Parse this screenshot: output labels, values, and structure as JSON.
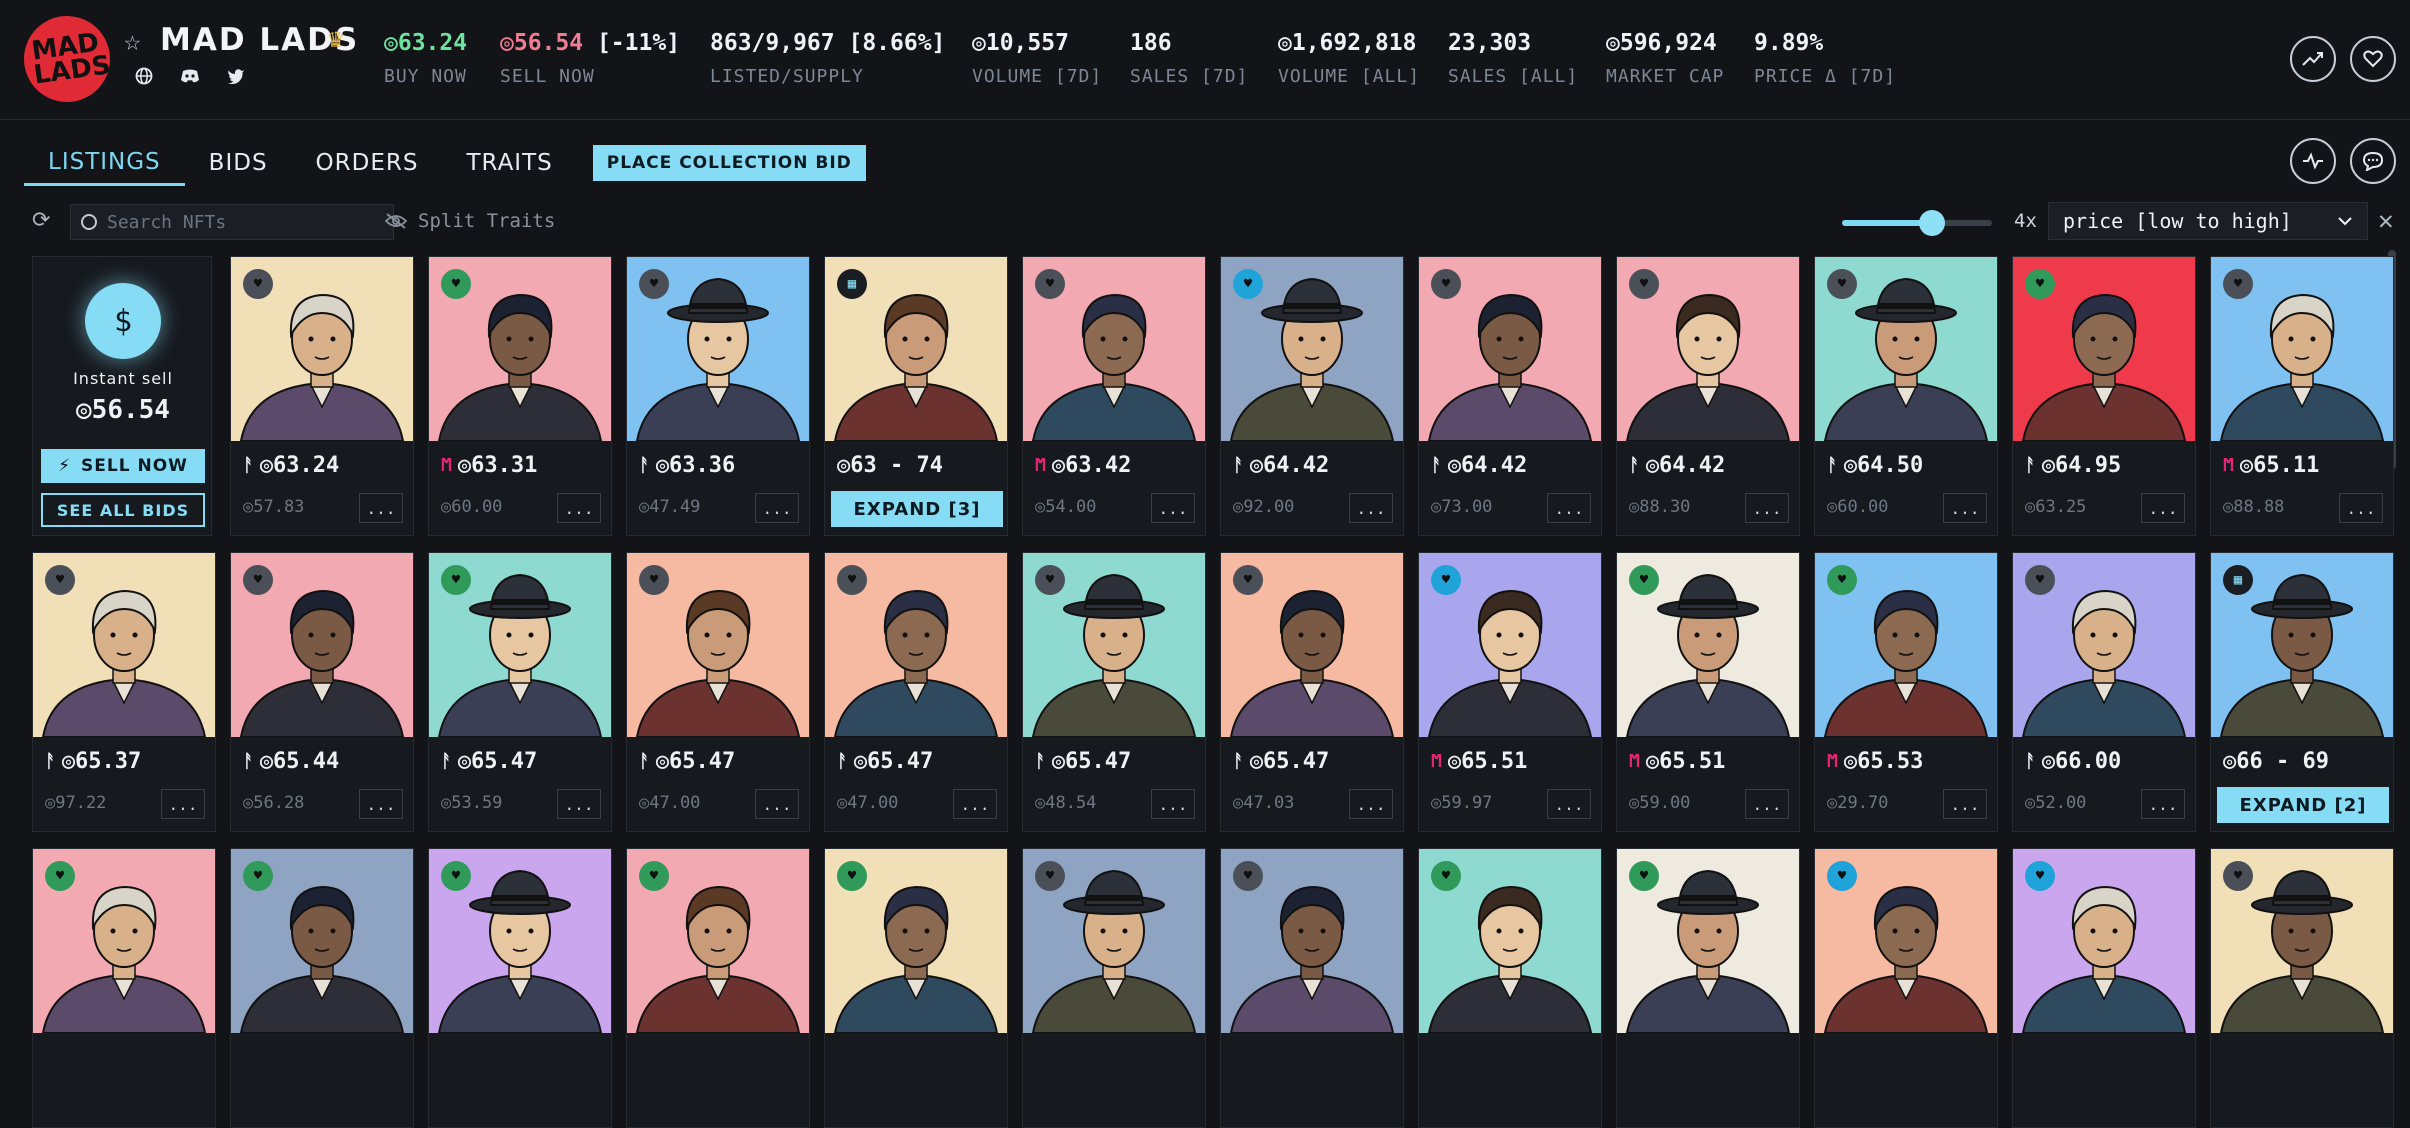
{
  "collection": {
    "logo_text": "MAD LADS",
    "title": "MAD LADS"
  },
  "stats": [
    {
      "value": "◎63.24",
      "label": "BUY NOW",
      "tone": "green"
    },
    {
      "value": "◎56.54",
      "extra": "[-11%]",
      "label": "SELL NOW",
      "tone": "red"
    },
    {
      "value": "863/9,967 [8.66%]",
      "label": "LISTED/SUPPLY"
    },
    {
      "value": "◎10,557",
      "label": "VOLUME [7D]"
    },
    {
      "value": "186",
      "label": "SALES [7D]"
    },
    {
      "value": "◎1,692,818",
      "label": "VOLUME [ALL]"
    },
    {
      "value": "23,303",
      "label": "SALES [ALL]"
    },
    {
      "value": "◎596,924",
      "label": "MARKET CAP"
    },
    {
      "value": "9.89%",
      "label": "PRICE Δ [7D]"
    }
  ],
  "tabs": [
    "LISTINGS",
    "BIDS",
    "ORDERS",
    "TRAITS"
  ],
  "collection_bid_label": "PLACE COLLECTION BID",
  "search": {
    "placeholder": "Search NFTs"
  },
  "split_traits": "Split Traits",
  "slider": {
    "value": 0.6
  },
  "zoom_label": "4x",
  "sort": {
    "selected": "price [low to high]"
  },
  "instant_sell": {
    "label": "Instant sell",
    "value": "◎56.54",
    "sell_now": "SELL NOW",
    "see_all_bids": "SEE ALL BIDS"
  },
  "colors": {
    "accent": "#86dcf5",
    "buy": "#6ee3a0",
    "sell": "#f37c92"
  },
  "row1": [
    {
      "market": "tensor",
      "price": "◎63.24",
      "sub": "◎57.83",
      "bg": "#f1dfb8",
      "badge": "#4a4f58"
    },
    {
      "market": "magiceden",
      "price": "◎63.31",
      "sub": "◎60.00",
      "bg": "#f3a9b2",
      "badge": "#2f9a5a"
    },
    {
      "market": "tensor",
      "price": "◎63.36",
      "sub": "◎47.49",
      "bg": "#7fc2f2",
      "badge": "#4a4f58"
    },
    {
      "range": "◎63 - 74",
      "expand": "EXPAND [3]",
      "bg": "#f1dfb8",
      "badge": "#1a1d22"
    },
    {
      "market": "magiceden",
      "price": "◎63.42",
      "sub": "◎54.00",
      "bg": "#f3a9b2",
      "badge": "#4a4f58"
    },
    {
      "market": "tensor",
      "price": "◎64.42",
      "sub": "◎92.00",
      "bg": "#8fa4c2",
      "badge": "#1fa3d8"
    },
    {
      "market": "tensor",
      "price": "◎64.42",
      "sub": "◎73.00",
      "bg": "#f3a9b2",
      "badge": "#4a4f58"
    },
    {
      "market": "tensor",
      "price": "◎64.42",
      "sub": "◎88.30",
      "bg": "#f3a9b2",
      "badge": "#4a4f58"
    },
    {
      "market": "tensor",
      "price": "◎64.50",
      "sub": "◎60.00",
      "bg": "#8edad0",
      "badge": "#4a4f58"
    },
    {
      "market": "tensor",
      "price": "◎64.95",
      "sub": "◎63.25",
      "bg": "#ee3a4a",
      "badge": "#2f9a5a"
    },
    {
      "market": "magiceden",
      "price": "◎65.11",
      "sub": "◎88.88",
      "bg": "#7fc2f2",
      "badge": "#4a4f58"
    }
  ],
  "row2": [
    {
      "market": "tensor",
      "price": "◎65.37",
      "sub": "◎97.22",
      "bg": "#f1dfb8",
      "badge": "#4a4f58"
    },
    {
      "market": "tensor",
      "price": "◎65.44",
      "sub": "◎56.28",
      "bg": "#f3a9b2",
      "badge": "#4a4f58"
    },
    {
      "market": "tensor",
      "price": "◎65.47",
      "sub": "◎53.59",
      "bg": "#8edad0",
      "badge": "#2f9a5a"
    },
    {
      "market": "tensor",
      "price": "◎65.47",
      "sub": "◎47.00",
      "bg": "#f6b9a2",
      "badge": "#4a4f58"
    },
    {
      "market": "tensor",
      "price": "◎65.47",
      "sub": "◎47.00",
      "bg": "#f6b9a2",
      "badge": "#4a4f58"
    },
    {
      "market": "tensor",
      "price": "◎65.47",
      "sub": "◎48.54",
      "bg": "#8edad0",
      "badge": "#4a4f58"
    },
    {
      "market": "tensor",
      "price": "◎65.47",
      "sub": "◎47.03",
      "bg": "#f6b9a2",
      "badge": "#4a4f58"
    },
    {
      "market": "magiceden",
      "price": "◎65.51",
      "sub": "◎59.97",
      "bg": "#a9a6ee",
      "badge": "#1fa3d8"
    },
    {
      "market": "magiceden",
      "price": "◎65.51",
      "sub": "◎59.00",
      "bg": "#efeadf",
      "badge": "#2f9a5a"
    },
    {
      "market": "magiceden",
      "price": "◎65.53",
      "sub": "◎29.70",
      "bg": "#7fc2f2",
      "badge": "#2f9a5a"
    },
    {
      "market": "tensor",
      "price": "◎66.00",
      "sub": "◎52.00",
      "bg": "#a9a6ee",
      "badge": "#4a4f58"
    },
    {
      "range": "◎66 - 69",
      "expand": "EXPAND [2]",
      "bg": "#7fc2f2",
      "badge": "#1a1d22"
    }
  ],
  "row3": [
    {
      "bg": "#f3a9b2",
      "badge": "#2f9a5a"
    },
    {
      "bg": "#8fa4c2",
      "badge": "#2f9a5a"
    },
    {
      "bg": "#c9a6ee",
      "badge": "#2f9a5a"
    },
    {
      "bg": "#f3a9b2",
      "badge": "#2f9a5a"
    },
    {
      "bg": "#f1dfb8",
      "badge": "#2f9a5a"
    },
    {
      "bg": "#8fa4c2",
      "badge": "#4a4f58"
    },
    {
      "bg": "#8fa4c2",
      "badge": "#4a4f58"
    },
    {
      "bg": "#8edad0",
      "badge": "#2f9a5a"
    },
    {
      "bg": "#efeadf",
      "badge": "#2f9a5a"
    },
    {
      "bg": "#f6b9a2",
      "badge": "#1fa3d8"
    },
    {
      "bg": "#c9a6ee",
      "badge": "#1fa3d8"
    },
    {
      "bg": "#f1dfb8",
      "badge": "#4a4f58"
    }
  ]
}
